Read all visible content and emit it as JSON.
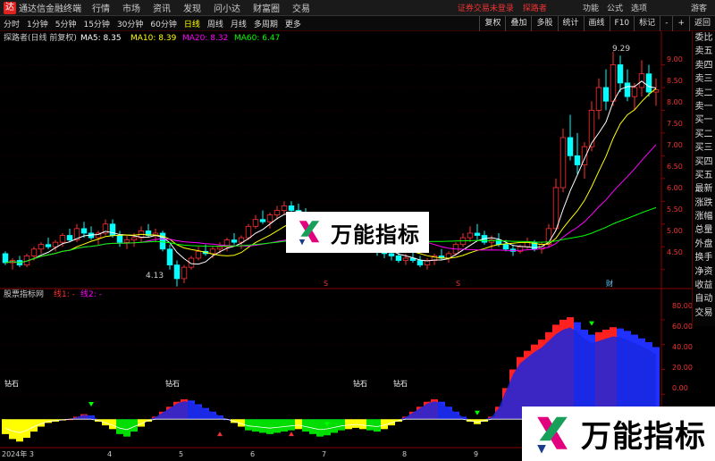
{
  "window": {
    "app_title": "通达信金融终端",
    "menus": [
      "行情",
      "市场",
      "资讯",
      "发现",
      "问小达",
      "财富圈",
      "交易"
    ],
    "login_warning": "证券交易未登录",
    "account": "探路者",
    "right_menus": [
      "功能",
      "公式",
      "选项"
    ],
    "user": "游客"
  },
  "periods": [
    {
      "label": "分时",
      "active": false
    },
    {
      "label": "1分钟",
      "active": false
    },
    {
      "label": "5分钟",
      "active": false
    },
    {
      "label": "15分钟",
      "active": false
    },
    {
      "label": "30分钟",
      "active": false
    },
    {
      "label": "60分钟",
      "active": false
    },
    {
      "label": "日线",
      "active": true
    },
    {
      "label": "周线",
      "active": false
    },
    {
      "label": "月线",
      "active": false
    },
    {
      "label": "多周期",
      "active": false
    },
    {
      "label": "更多",
      "active": false
    }
  ],
  "toolbar": [
    "复权",
    "叠加",
    "多股",
    "统计",
    "画线",
    "F10",
    "标记",
    "-",
    "+",
    "返回"
  ],
  "main_chart": {
    "title": "探路者(日线 前复权)",
    "ma_labels": [
      {
        "text": "MA5: 8.35",
        "color": "#ffffff"
      },
      {
        "text": "MA10: 8.39",
        "color": "#ffff00"
      },
      {
        "text": "MA20: 8.32",
        "color": "#ff00ff"
      },
      {
        "text": "MA60: 6.47",
        "color": "#00ff00"
      }
    ],
    "y_ticks": [
      "9.00",
      "8.50",
      "8.00",
      "7.50",
      "7.00",
      "6.50",
      "6.00",
      "5.50",
      "5.00",
      "4.50"
    ],
    "high_label": "9.29",
    "low_label": "4.13",
    "marks": [
      "S",
      "S",
      "财"
    ]
  },
  "side_tabs": [
    "委比",
    "卖五",
    "卖四",
    "卖三",
    "卖二",
    "卖一",
    "买一",
    "买二",
    "买三",
    "买四",
    "买五",
    "最新",
    "涨跌",
    "涨幅",
    "总量",
    "外盘",
    "换手",
    "净资",
    "收益",
    "自动",
    "交易"
  ],
  "indicator": {
    "title": "股票指标网",
    "line1": "线1: -",
    "line2": "线2: -",
    "y_ticks": [
      "80.00",
      "60.00",
      "40.00",
      "20.00",
      "0.00"
    ],
    "signal_text": "钻石"
  },
  "x_axis": [
    "2024年 3",
    "4",
    "5",
    "6",
    "7",
    "8",
    "9"
  ],
  "watermark": {
    "text": "万能指标"
  },
  "chart_data": {
    "type": "candlestick",
    "title": "探路者(日线 前复权)",
    "series": [
      {
        "name": "MA5"
      },
      {
        "name": "MA10"
      },
      {
        "name": "MA20"
      },
      {
        "name": "MA60"
      }
    ],
    "y_range": [
      4.2,
      9.5
    ],
    "high": 9.29,
    "low": 4.13,
    "candles": [
      [
        4.85,
        4.9,
        4.6,
        4.65
      ],
      [
        4.65,
        4.75,
        4.5,
        4.7
      ],
      [
        4.7,
        4.8,
        4.55,
        4.6
      ],
      [
        4.6,
        4.85,
        4.55,
        4.8
      ],
      [
        4.8,
        5.0,
        4.7,
        4.95
      ],
      [
        4.95,
        5.1,
        4.85,
        5.05
      ],
      [
        5.05,
        5.2,
        4.95,
        5.0
      ],
      [
        5.0,
        5.15,
        4.9,
        5.1
      ],
      [
        5.1,
        5.3,
        5.0,
        5.25
      ],
      [
        5.25,
        5.4,
        5.1,
        5.15
      ],
      [
        5.15,
        5.5,
        5.1,
        5.4
      ],
      [
        5.4,
        5.55,
        5.2,
        5.3
      ],
      [
        5.3,
        5.45,
        5.15,
        5.2
      ],
      [
        5.2,
        5.35,
        5.05,
        5.3
      ],
      [
        5.3,
        5.6,
        5.25,
        5.5
      ],
      [
        5.5,
        5.6,
        5.2,
        5.25
      ],
      [
        5.25,
        5.35,
        5.0,
        5.1
      ],
      [
        5.1,
        5.25,
        4.95,
        5.15
      ],
      [
        5.15,
        5.3,
        5.0,
        5.2
      ],
      [
        5.2,
        5.45,
        5.1,
        5.35
      ],
      [
        5.35,
        5.5,
        5.2,
        5.25
      ],
      [
        5.25,
        5.4,
        5.1,
        5.3
      ],
      [
        5.3,
        5.35,
        4.9,
        4.95
      ],
      [
        4.95,
        5.05,
        4.5,
        4.6
      ],
      [
        4.6,
        4.7,
        4.13,
        4.3
      ],
      [
        4.3,
        4.6,
        4.2,
        4.55
      ],
      [
        4.55,
        4.8,
        4.5,
        4.75
      ],
      [
        4.75,
        5.0,
        4.7,
        4.9
      ],
      [
        4.9,
        5.05,
        4.8,
        4.85
      ],
      [
        4.85,
        5.0,
        4.75,
        4.95
      ],
      [
        4.95,
        5.1,
        4.85,
        5.0
      ],
      [
        5.0,
        5.2,
        4.9,
        5.15
      ],
      [
        5.15,
        5.3,
        5.05,
        5.1
      ],
      [
        5.1,
        5.25,
        4.95,
        5.2
      ],
      [
        5.2,
        5.5,
        5.15,
        5.45
      ],
      [
        5.45,
        5.7,
        5.4,
        5.6
      ],
      [
        5.6,
        5.8,
        5.5,
        5.55
      ],
      [
        5.55,
        5.75,
        5.4,
        5.7
      ],
      [
        5.7,
        5.9,
        5.6,
        5.8
      ],
      [
        5.8,
        6.0,
        5.7,
        5.9
      ],
      [
        5.9,
        6.0,
        5.75,
        5.8
      ],
      [
        5.8,
        5.95,
        5.65,
        5.7
      ],
      [
        5.7,
        5.85,
        5.5,
        5.55
      ],
      [
        5.55,
        5.7,
        5.35,
        5.4
      ],
      [
        5.4,
        5.55,
        5.2,
        5.3
      ],
      [
        5.3,
        5.5,
        5.2,
        5.45
      ],
      [
        5.45,
        5.6,
        5.3,
        5.35
      ],
      [
        5.35,
        5.45,
        5.1,
        5.2
      ],
      [
        5.2,
        5.35,
        5.0,
        5.05
      ],
      [
        5.05,
        5.2,
        4.95,
        5.15
      ],
      [
        5.15,
        5.3,
        5.05,
        5.1
      ],
      [
        5.1,
        5.2,
        4.9,
        4.95
      ],
      [
        4.95,
        5.05,
        4.8,
        4.9
      ],
      [
        4.9,
        5.0,
        4.75,
        4.85
      ],
      [
        4.85,
        4.95,
        4.7,
        4.8
      ],
      [
        4.8,
        4.9,
        4.65,
        4.7
      ],
      [
        4.7,
        4.85,
        4.6,
        4.75
      ],
      [
        4.75,
        4.9,
        4.65,
        4.7
      ],
      [
        4.7,
        4.8,
        4.55,
        4.6
      ],
      [
        4.6,
        4.75,
        4.5,
        4.7
      ],
      [
        4.7,
        4.85,
        4.6,
        4.8
      ],
      [
        4.8,
        4.95,
        4.7,
        4.75
      ],
      [
        4.75,
        4.9,
        4.65,
        4.85
      ],
      [
        4.85,
        5.1,
        4.8,
        5.05
      ],
      [
        5.05,
        5.3,
        5.0,
        5.2
      ],
      [
        5.2,
        5.45,
        5.1,
        5.3
      ],
      [
        5.3,
        5.5,
        5.15,
        5.25
      ],
      [
        5.25,
        5.35,
        5.05,
        5.1
      ],
      [
        5.1,
        5.25,
        4.95,
        5.15
      ],
      [
        5.15,
        5.3,
        5.0,
        5.05
      ],
      [
        5.05,
        5.15,
        4.9,
        4.95
      ],
      [
        4.95,
        5.05,
        4.8,
        4.9
      ],
      [
        4.9,
        5.05,
        4.85,
        5.0
      ],
      [
        5.0,
        5.2,
        4.95,
        5.1
      ],
      [
        5.1,
        5.15,
        4.9,
        4.95
      ],
      [
        4.95,
        5.1,
        4.85,
        5.05
      ],
      [
        5.05,
        5.5,
        5.0,
        5.4
      ],
      [
        5.4,
        6.5,
        5.35,
        6.3
      ],
      [
        6.3,
        7.6,
        6.2,
        7.4
      ],
      [
        7.4,
        7.9,
        6.9,
        7.0
      ],
      [
        7.0,
        7.5,
        6.6,
        6.8
      ],
      [
        6.8,
        7.3,
        6.5,
        7.2
      ],
      [
        7.2,
        8.2,
        7.1,
        8.0
      ],
      [
        8.0,
        8.7,
        7.8,
        8.5
      ],
      [
        8.5,
        8.9,
        8.0,
        8.2
      ],
      [
        8.2,
        9.29,
        8.1,
        9.0
      ],
      [
        9.0,
        9.2,
        8.4,
        8.6
      ],
      [
        8.6,
        8.9,
        8.2,
        8.3
      ],
      [
        8.3,
        8.6,
        8.0,
        8.5
      ],
      [
        8.5,
        9.1,
        8.3,
        8.8
      ],
      [
        8.8,
        9.0,
        8.3,
        8.4
      ],
      [
        8.4,
        8.7,
        8.1,
        8.45
      ]
    ],
    "indicator": {
      "name": "股票指标网",
      "y_range": [
        -20,
        95
      ],
      "values": [
        -12,
        -16,
        -18,
        -15,
        -10,
        -6,
        -3,
        -2,
        -1,
        0,
        2,
        4,
        3,
        -2,
        -5,
        -8,
        -12,
        -14,
        -10,
        -6,
        -2,
        2,
        6,
        10,
        14,
        16,
        15,
        12,
        9,
        6,
        3,
        0,
        -3,
        -6,
        -9,
        -10,
        -11,
        -12,
        -11,
        -10,
        -9,
        -8,
        -10,
        -12,
        -14,
        -13,
        -11,
        -9,
        -8,
        -7,
        -8,
        -9,
        -10,
        -8,
        -5,
        -2,
        2,
        6,
        10,
        14,
        16,
        14,
        10,
        6,
        2,
        -2,
        -4,
        -2,
        2,
        10,
        25,
        40,
        50,
        55,
        60,
        64,
        70,
        76,
        80,
        82,
        78,
        72,
        68,
        70,
        72,
        74,
        73,
        71,
        68,
        65,
        62,
        58
      ]
    }
  }
}
